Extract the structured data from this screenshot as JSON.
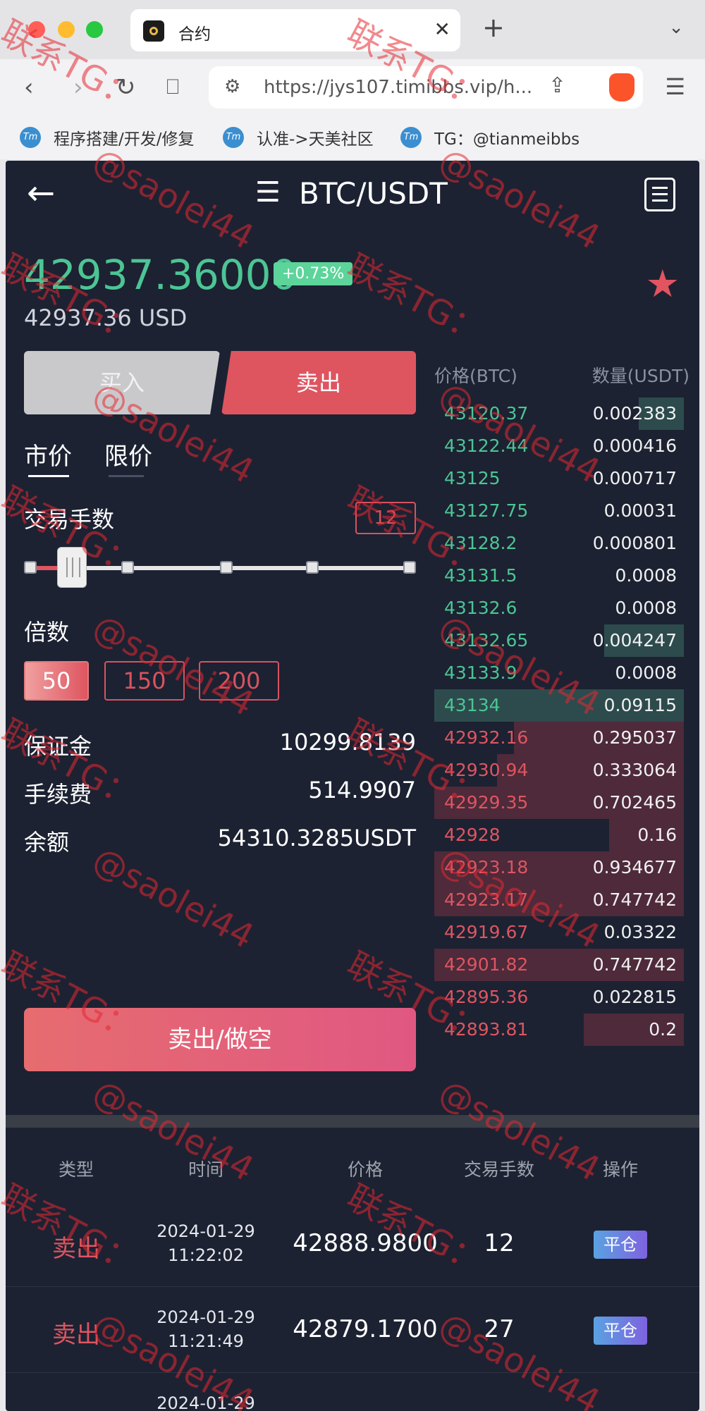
{
  "browser": {
    "tab_title": "合约",
    "url": "https://jys107.timibbs.vip/h...",
    "bookmarks": [
      "程序搭建/开发/修复",
      "认准->天美社区",
      "TG：@tianmeibbs"
    ]
  },
  "header": {
    "title": "BTC/USDT"
  },
  "ticker": {
    "price": "42937.36000",
    "change": "+0.73%",
    "usd": "42937.36 USD"
  },
  "side_tabs": {
    "buy": "买入",
    "sell": "卖出"
  },
  "order_type_tabs": {
    "market": "市价",
    "limit": "限价"
  },
  "lots": {
    "label": "交易手数",
    "value": "12",
    "slider_fraction": 0.1
  },
  "leverage": {
    "label": "倍数",
    "options": [
      "50",
      "150",
      "200"
    ],
    "selected": "50"
  },
  "summary": {
    "margin_label": "保证金",
    "margin_value": "10299.8139",
    "fee_label": "手续费",
    "fee_value": "514.9907",
    "balance_label": "余额",
    "balance_value": "54310.3285USDT"
  },
  "submit_label": "卖出/做空",
  "orderbook": {
    "price_header": "价格(BTC)",
    "qty_header": "数量(USDT)",
    "asks": [
      {
        "price": "43120.37",
        "qty": "0.002383",
        "depth": 0.18
      },
      {
        "price": "43122.44",
        "qty": "0.000416",
        "depth": 0.0
      },
      {
        "price": "43125",
        "qty": "0.000717",
        "depth": 0.0
      },
      {
        "price": "43127.75",
        "qty": "0.00031",
        "depth": 0.0
      },
      {
        "price": "43128.2",
        "qty": "0.000801",
        "depth": 0.0
      },
      {
        "price": "43131.5",
        "qty": "0.0008",
        "depth": 0.0
      },
      {
        "price": "43132.6",
        "qty": "0.0008",
        "depth": 0.0
      },
      {
        "price": "43132.65",
        "qty": "0.004247",
        "depth": 0.32
      },
      {
        "price": "43133.9",
        "qty": "0.0008",
        "depth": 0.0
      },
      {
        "price": "43134",
        "qty": "0.09115",
        "depth": 1.0
      }
    ],
    "bids": [
      {
        "price": "42932.16",
        "qty": "0.295037",
        "depth": 0.68
      },
      {
        "price": "42930.94",
        "qty": "0.333064",
        "depth": 0.75
      },
      {
        "price": "42929.35",
        "qty": "0.702465",
        "depth": 1.0
      },
      {
        "price": "42928",
        "qty": "0.16",
        "depth": 0.3
      },
      {
        "price": "42923.18",
        "qty": "0.934677",
        "depth": 1.0
      },
      {
        "price": "42923.17",
        "qty": "0.747742",
        "depth": 1.0
      },
      {
        "price": "42919.67",
        "qty": "0.03322",
        "depth": 0.0
      },
      {
        "price": "42901.82",
        "qty": "0.747742",
        "depth": 1.0
      },
      {
        "price": "42895.36",
        "qty": "0.022815",
        "depth": 0.0
      },
      {
        "price": "42893.81",
        "qty": "0.2",
        "depth": 0.4
      }
    ]
  },
  "history": {
    "headers": [
      "类型",
      "时间",
      "价格",
      "交易手数",
      "操作"
    ],
    "rows": [
      {
        "type": "卖出",
        "date": "2024-01-29",
        "time": "11:22:02",
        "price": "42888.9800",
        "lots": "12",
        "action": "平仓"
      },
      {
        "type": "卖出",
        "date": "2024-01-29",
        "time": "11:21:49",
        "price": "42879.1700",
        "lots": "27",
        "action": "平仓"
      },
      {
        "type": "",
        "date": "2024-01-29",
        "time": "",
        "price": "",
        "lots": "",
        "action": ""
      }
    ]
  },
  "watermarks": [
    "联系TG：",
    "@saolei44"
  ],
  "colors": {
    "bg": "#1c2232",
    "up": "#4cc594",
    "down": "#de5560",
    "accent": "#de5560"
  }
}
